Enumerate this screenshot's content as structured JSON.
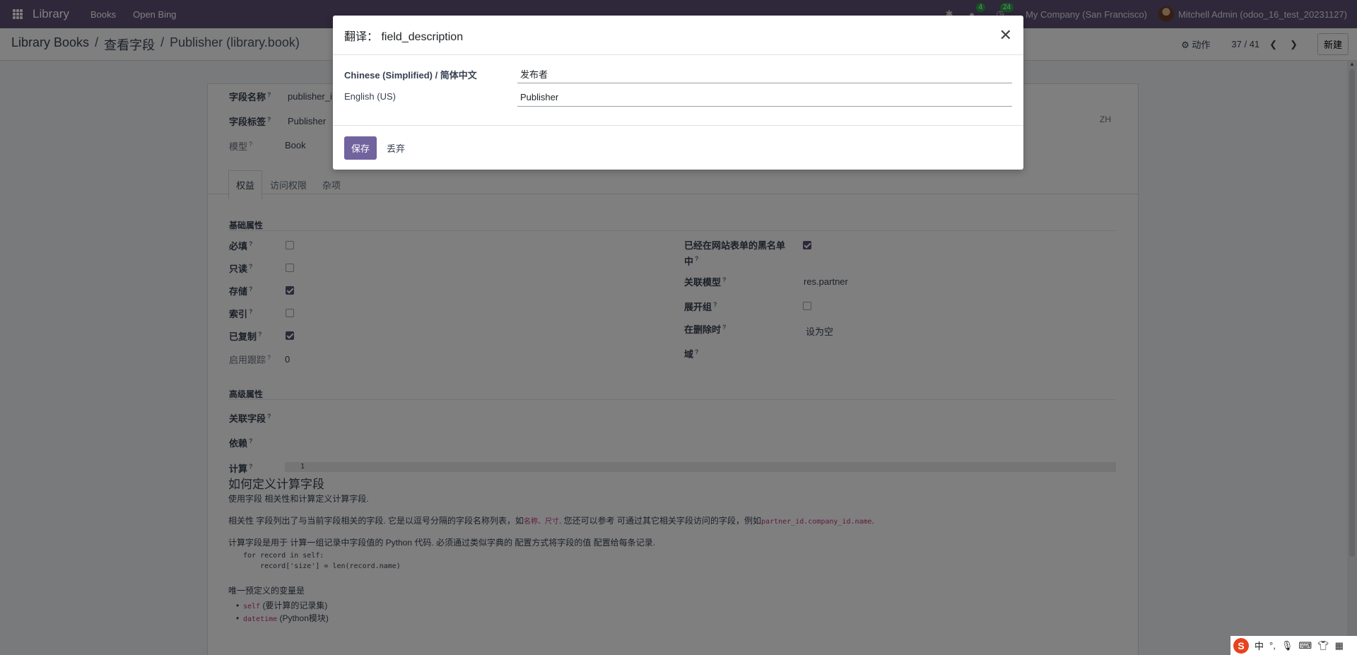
{
  "navbar": {
    "app_name": "Library",
    "menus": [
      "Books",
      "Open Bing"
    ],
    "chat_count": "4",
    "activity_count": "24",
    "company": "My Company (San Francisco)",
    "user": "Mitchell Admin (odoo_16_test_20231127)"
  },
  "control_panel": {
    "breadcrumb": [
      "Library Books",
      "查看字段",
      "Publisher (library.book)"
    ],
    "separator": "/",
    "action_label": "动作",
    "pager": "37 / 41",
    "new_label": "新建"
  },
  "form": {
    "field_name_label": "字段名称",
    "field_name_value": "publisher_i",
    "field_label_label": "字段标签",
    "field_label_value": "Publisher",
    "lang_badge": "ZH",
    "model_label": "模型",
    "model_value": "Book",
    "tabs": [
      "权益",
      "访问权限",
      "杂项"
    ],
    "basic_section": "基础属性",
    "left_fields": [
      {
        "label": "必填",
        "checked": false
      },
      {
        "label": "只读",
        "checked": false
      },
      {
        "label": "存储",
        "checked": true
      },
      {
        "label": "索引",
        "checked": false
      },
      {
        "label": "已复制",
        "checked": true
      }
    ],
    "tracking_label": "启用跟踪",
    "tracking_value": "0",
    "right_fields": {
      "blacklist_label": "已经在网站表单的黑名单中",
      "blacklist_checked": true,
      "relation_label": "关联模型",
      "relation_value": "res.partner",
      "group_expand_label": "展开组",
      "group_expand_checked": false,
      "ondelete_label": "在删除时",
      "ondelete_value": "设为空",
      "domain_label": "域"
    },
    "advanced_section": "高级属性",
    "related_label": "关联字段",
    "depends_label": "依赖",
    "compute_label": "计算",
    "compute_line_no": "1",
    "help": {
      "title": "如何定义计算字段",
      "p1": "使用字段 相关性和计算定义计算字段.",
      "p2_a": "相关性 字段列出了与当前字段相关的字段. 它是以逗号分隔的字段名称列表，如",
      "p2_code1": "名称、尺寸",
      "p2_b": ". 您还可以参考 可通过其它相关字段访问的字段，例如",
      "p2_code2": "partner_id.company_id.name",
      "p2_c": ".",
      "p3": "计算字段是用于 计算一组记录中字段值的 Python 代码. 必须通过类似字典的 配置方式将字段的值 配置给每条记录.",
      "code": "for record in self:\n    record['size'] = len(record.name)",
      "p4": "唯一预定义的变量是",
      "vars": [
        {
          "code": "self",
          "desc": "(要计算的记录集)"
        },
        {
          "code": "datetime",
          "desc": "(Python模块)"
        }
      ]
    }
  },
  "modal": {
    "title_prefix": "翻译：",
    "title_field": "field_description",
    "rows": [
      {
        "lang": "Chinese (Simplified) / 简体中文",
        "value": "发布者"
      },
      {
        "lang": "English (US)",
        "value": "Publisher"
      }
    ],
    "save_label": "保存",
    "discard_label": "丢弃"
  },
  "ime": {
    "logo": "S",
    "mode": "中"
  }
}
